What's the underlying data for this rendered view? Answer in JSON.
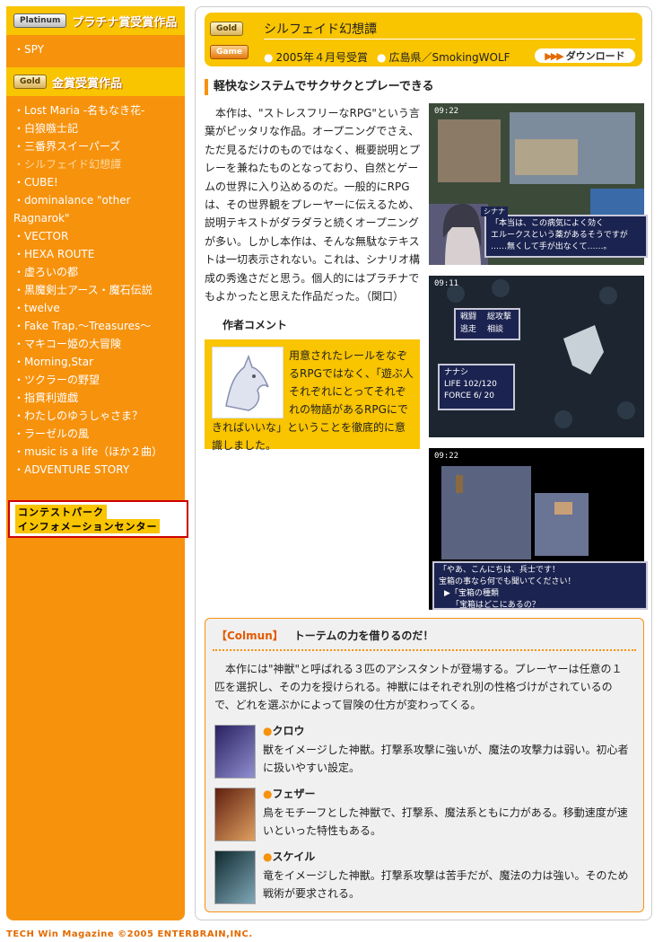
{
  "sidebar": {
    "platinum": {
      "badge": "Platinum",
      "title": "プラチナ賞受賞作品",
      "items": [
        "・SPY"
      ]
    },
    "gold": {
      "badge": "Gold",
      "title": "金賞受賞作品",
      "items": [
        "・Lost Maria -名もなき花-",
        "・白狼嗾士記",
        "・三番界スイーパーズ",
        "・シルフェイド幻想譚",
        "・CUBE!",
        "・dominalance \"other Ragnarok\"",
        "・VECTOR",
        "・HEXA ROUTE",
        "・虚ろいの都",
        "・黒魔剣士アース・魔石伝説",
        "・twelve",
        "・Fake Trap.～Treasures～",
        "・マキコー姫の大冒険",
        "・Morning,Star",
        "・ツクラーの野望",
        "・指貫利遊戯",
        "・わたしのゆうしゃさま？",
        "・ラーゼルの風",
        "・music is a life（ほか２曲）",
        "・ADVENTURE STORY"
      ],
      "current_index": 3
    },
    "info_banner": {
      "line1": "コンテストパーク",
      "line2": "インフォメーションセンター"
    }
  },
  "header": {
    "gold_badge": "Gold",
    "game_badge": "Game",
    "title": "シルフェイド幻想譚",
    "date": "2005年４月号受賞",
    "author": "広島県／SmokingWOLF",
    "download": "ダウンロード"
  },
  "article": {
    "heading": "軽快なシステムでサクサクとプレーできる",
    "body": "本作は、\"ストレスフリーなRPG\"という言葉がピッタリな作品。オープニングでさえ、ただ見るだけのものではなく、概要説明とプレーを兼ねたものとなっており、自然とゲームの世界に入り込めるのだ。一般的にRPGは、その世界観をプレーヤーに伝えるため、説明テキストがダラダラと続くオープニングが多い。しかし本作は、そんな無駄なテキストは一切表示されない。これは、シナリオ構成の秀逸さだと思う。個人的にはプラチナでもよかったと思えた作品だった。（関口）",
    "comment_heading": "作者コメント",
    "comment": "用意されたレールをなぞるRPGではなく、「遊ぶ人それぞれにとってそれぞれの物語があるRPGにできればいいな」ということを徹底的に意識しました。"
  },
  "screens": [
    {
      "clock": "09:22",
      "speaker": "シナナ",
      "lines": [
        "「本当は、この病気によく効く",
        "エルークスという薬があるそうですが",
        "……無くして手が出なくて……。"
      ]
    },
    {
      "clock": "09:11",
      "menu": [
        "戦闘",
        "総攻撃",
        "逃走",
        "相談"
      ],
      "name": "ナナシ",
      "life_label": "LIFE",
      "life": "102/120",
      "force_label": "FORCE",
      "force": "6/ 20"
    },
    {
      "clock": "09:22",
      "lines": [
        "「やあ、こんにちは、兵士です！",
        "宝箱の事なら何でも聞いてください！",
        "▶「宝箱の種類",
        "「宝箱はどこにあるの？"
      ]
    }
  ],
  "column": {
    "tag": "【Colmun】",
    "title": "トーテムの力を借りるのだ！",
    "intro": "本作には\"神獣\"と呼ばれる３匹のアシスタントが登場する。プレーヤーは任意の１匹を選択し、その力を授けられる。神獣にはそれぞれ別の性格づけがされているので、どれを選ぶかによって冒険の仕方が変わってくる。",
    "creatures": [
      {
        "name": "クロウ",
        "desc": "獣をイメージした神獣。打撃系攻撃に強いが、魔法の攻撃力は弱い。初心者に扱いやすい設定。"
      },
      {
        "name": "フェザー",
        "desc": "鳥をモチーフとした神獣で、打撃系、魔法系ともに力がある。移動速度が速いといった特性もある。"
      },
      {
        "name": "スケイル",
        "desc": "竜をイメージした神獣。打撃系攻撃は苦手だが、魔法の力は強い。そのため戦術が要求される。"
      }
    ]
  },
  "footer": "TECH Win Magazine ©2005 ENTERBRAIN,INC."
}
